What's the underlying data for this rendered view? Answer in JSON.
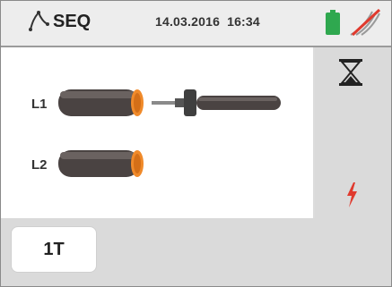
{
  "header": {
    "mode_icon": "phase-sequence-icon",
    "title": "SEQ",
    "date": "14.03.2016",
    "time": "16:34",
    "battery_icon": "battery-icon",
    "battery_color": "#2fa84f",
    "signal_icon": "signal-disabled-icon",
    "signal_slash_color": "#e03a2e"
  },
  "panel": {
    "probes": [
      {
        "label": "L1",
        "connected": true
      },
      {
        "label": "L2",
        "connected": false
      }
    ],
    "cable_end_color": "#f08a2a"
  },
  "sidebar": {
    "hourglass_icon": "hourglass-icon",
    "bolt_icon": "lightning-bolt-icon",
    "bolt_color": "#e03a2e"
  },
  "bottom": {
    "keys": [
      {
        "label": "1T"
      }
    ]
  }
}
